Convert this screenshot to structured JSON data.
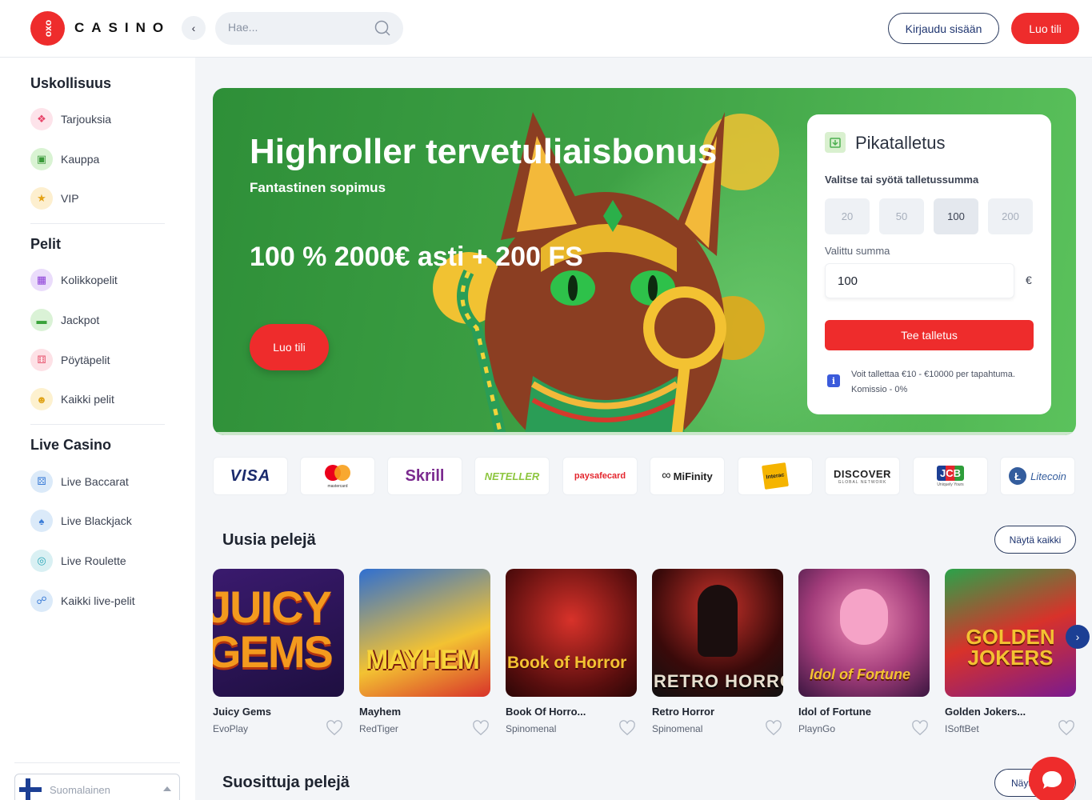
{
  "header": {
    "logo_mark": "oxo",
    "logo_text": "CASINO",
    "search_placeholder": "Hae...",
    "login_label": "Kirjaudu sisään",
    "signup_label": "Luo tili"
  },
  "sidebar": {
    "sections": [
      {
        "title": "Uskollisuus",
        "items": [
          {
            "label": "Tarjouksia",
            "icon": "gift-icon"
          },
          {
            "label": "Kauppa",
            "icon": "shop-icon"
          },
          {
            "label": "VIP",
            "icon": "vip-icon"
          }
        ]
      },
      {
        "title": "Pelit",
        "items": [
          {
            "label": "Kolikkopelit",
            "icon": "slot-icon"
          },
          {
            "label": "Jackpot",
            "icon": "jackpot-icon"
          },
          {
            "label": "Pöytäpelit",
            "icon": "dice-icon"
          },
          {
            "label": "Kaikki pelit",
            "icon": "all-games-icon"
          }
        ]
      },
      {
        "title": "Live Casino",
        "items": [
          {
            "label": "Live Baccarat",
            "icon": "baccarat-icon"
          },
          {
            "label": "Live Blackjack",
            "icon": "blackjack-icon"
          },
          {
            "label": "Live Roulette",
            "icon": "roulette-icon"
          },
          {
            "label": "Kaikki live-pelit",
            "icon": "live-games-icon"
          }
        ]
      }
    ],
    "language": "Suomalainen"
  },
  "hero": {
    "title": "Highroller tervetuliaisbonus",
    "subtitle": "Fantastinen sopimus",
    "offer": "100 % 2000€ asti + 200 FS",
    "cta": "Luo tili"
  },
  "deposit": {
    "title": "Pikatalletus",
    "choose_label": "Valitse tai syötä talletussumma",
    "amounts": [
      "20",
      "50",
      "100",
      "200"
    ],
    "selected_amount_index": 2,
    "selected_label": "Valittu summa",
    "selected_value": "100",
    "currency": "€",
    "submit_label": "Tee talletus",
    "info_icon": "i",
    "info_text": "Voit tallettaa €10 - €10000 per tapahtuma. Komissio - 0%"
  },
  "payments": [
    "VISA",
    "mastercard",
    "Skrill",
    "NETELLER",
    "paysafecard",
    "MiFinity",
    "Interac",
    "DISCOVER",
    "JCB",
    "Litecoin"
  ],
  "payment_details": {
    "discover_sub": "GLOBAL NETWORK",
    "jcb_sub": "Uniquely Yours"
  },
  "new_games": {
    "title": "Uusia pelejä",
    "show_all": "Näytä kaikki",
    "games": [
      {
        "name": "Juicy Gems",
        "provider": "EvoPlay",
        "art": "JUICY GEMS"
      },
      {
        "name": "Mayhem",
        "provider": "RedTiger",
        "art": "MAYHEM"
      },
      {
        "name": "Book Of Horro...",
        "provider": "Spinomenal",
        "art": "Book of Horror"
      },
      {
        "name": "Retro Horror",
        "provider": "Spinomenal",
        "art": "RETRO HORROR"
      },
      {
        "name": "Idol of Fortune",
        "provider": "PlaynGo",
        "art": "Idol of Fortune"
      },
      {
        "name": "Golden Jokers...",
        "provider": "ISoftBet",
        "art": "GOLDEN JOKERS"
      }
    ]
  },
  "popular_games": {
    "title": "Suosittuja pelejä",
    "show_all": "Näyt"
  },
  "colors": {
    "brand_red": "#ee2c2c",
    "hero_green": "#3ea145",
    "navy": "#1c3f94"
  }
}
